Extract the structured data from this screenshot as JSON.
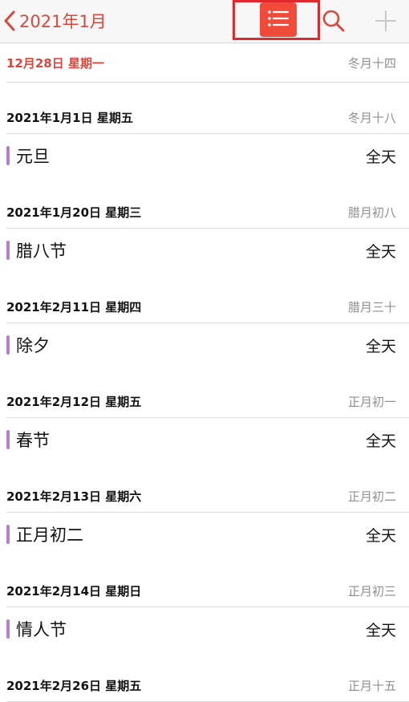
{
  "colors": {
    "accent": "#d9473c",
    "list_button_bg": "#f04a3b",
    "highlight_box": "#e0292c",
    "event_bar": "#b77fce",
    "lunar_gray": "#8e8e93"
  },
  "navbar": {
    "back_label": "2021年1月",
    "back_icon": "chevron-left-icon",
    "list_icon": "list-icon",
    "search_icon": "search-icon",
    "add_icon": "plus-icon"
  },
  "today": {
    "date": "12月28日 星期一",
    "lunar": "冬月十四"
  },
  "sections": [
    {
      "date": "2021年1月1日 星期五",
      "lunar": "冬月十八",
      "event": "元旦",
      "time": "全天"
    },
    {
      "date": "2021年1月20日 星期三",
      "lunar": "腊月初八",
      "event": "腊八节",
      "time": "全天"
    },
    {
      "date": "2021年2月11日 星期四",
      "lunar": "腊月三十",
      "event": "除夕",
      "time": "全天"
    },
    {
      "date": "2021年2月12日 星期五",
      "lunar": "正月初一",
      "event": "春节",
      "time": "全天"
    },
    {
      "date": "2021年2月13日 星期六",
      "lunar": "正月初二",
      "event": "正月初二",
      "time": "全天"
    },
    {
      "date": "2021年2月14日 星期日",
      "lunar": "正月初三",
      "event": "情人节",
      "time": "全天"
    },
    {
      "date": "2021年2月26日 星期五",
      "lunar": "正月十五"
    }
  ]
}
